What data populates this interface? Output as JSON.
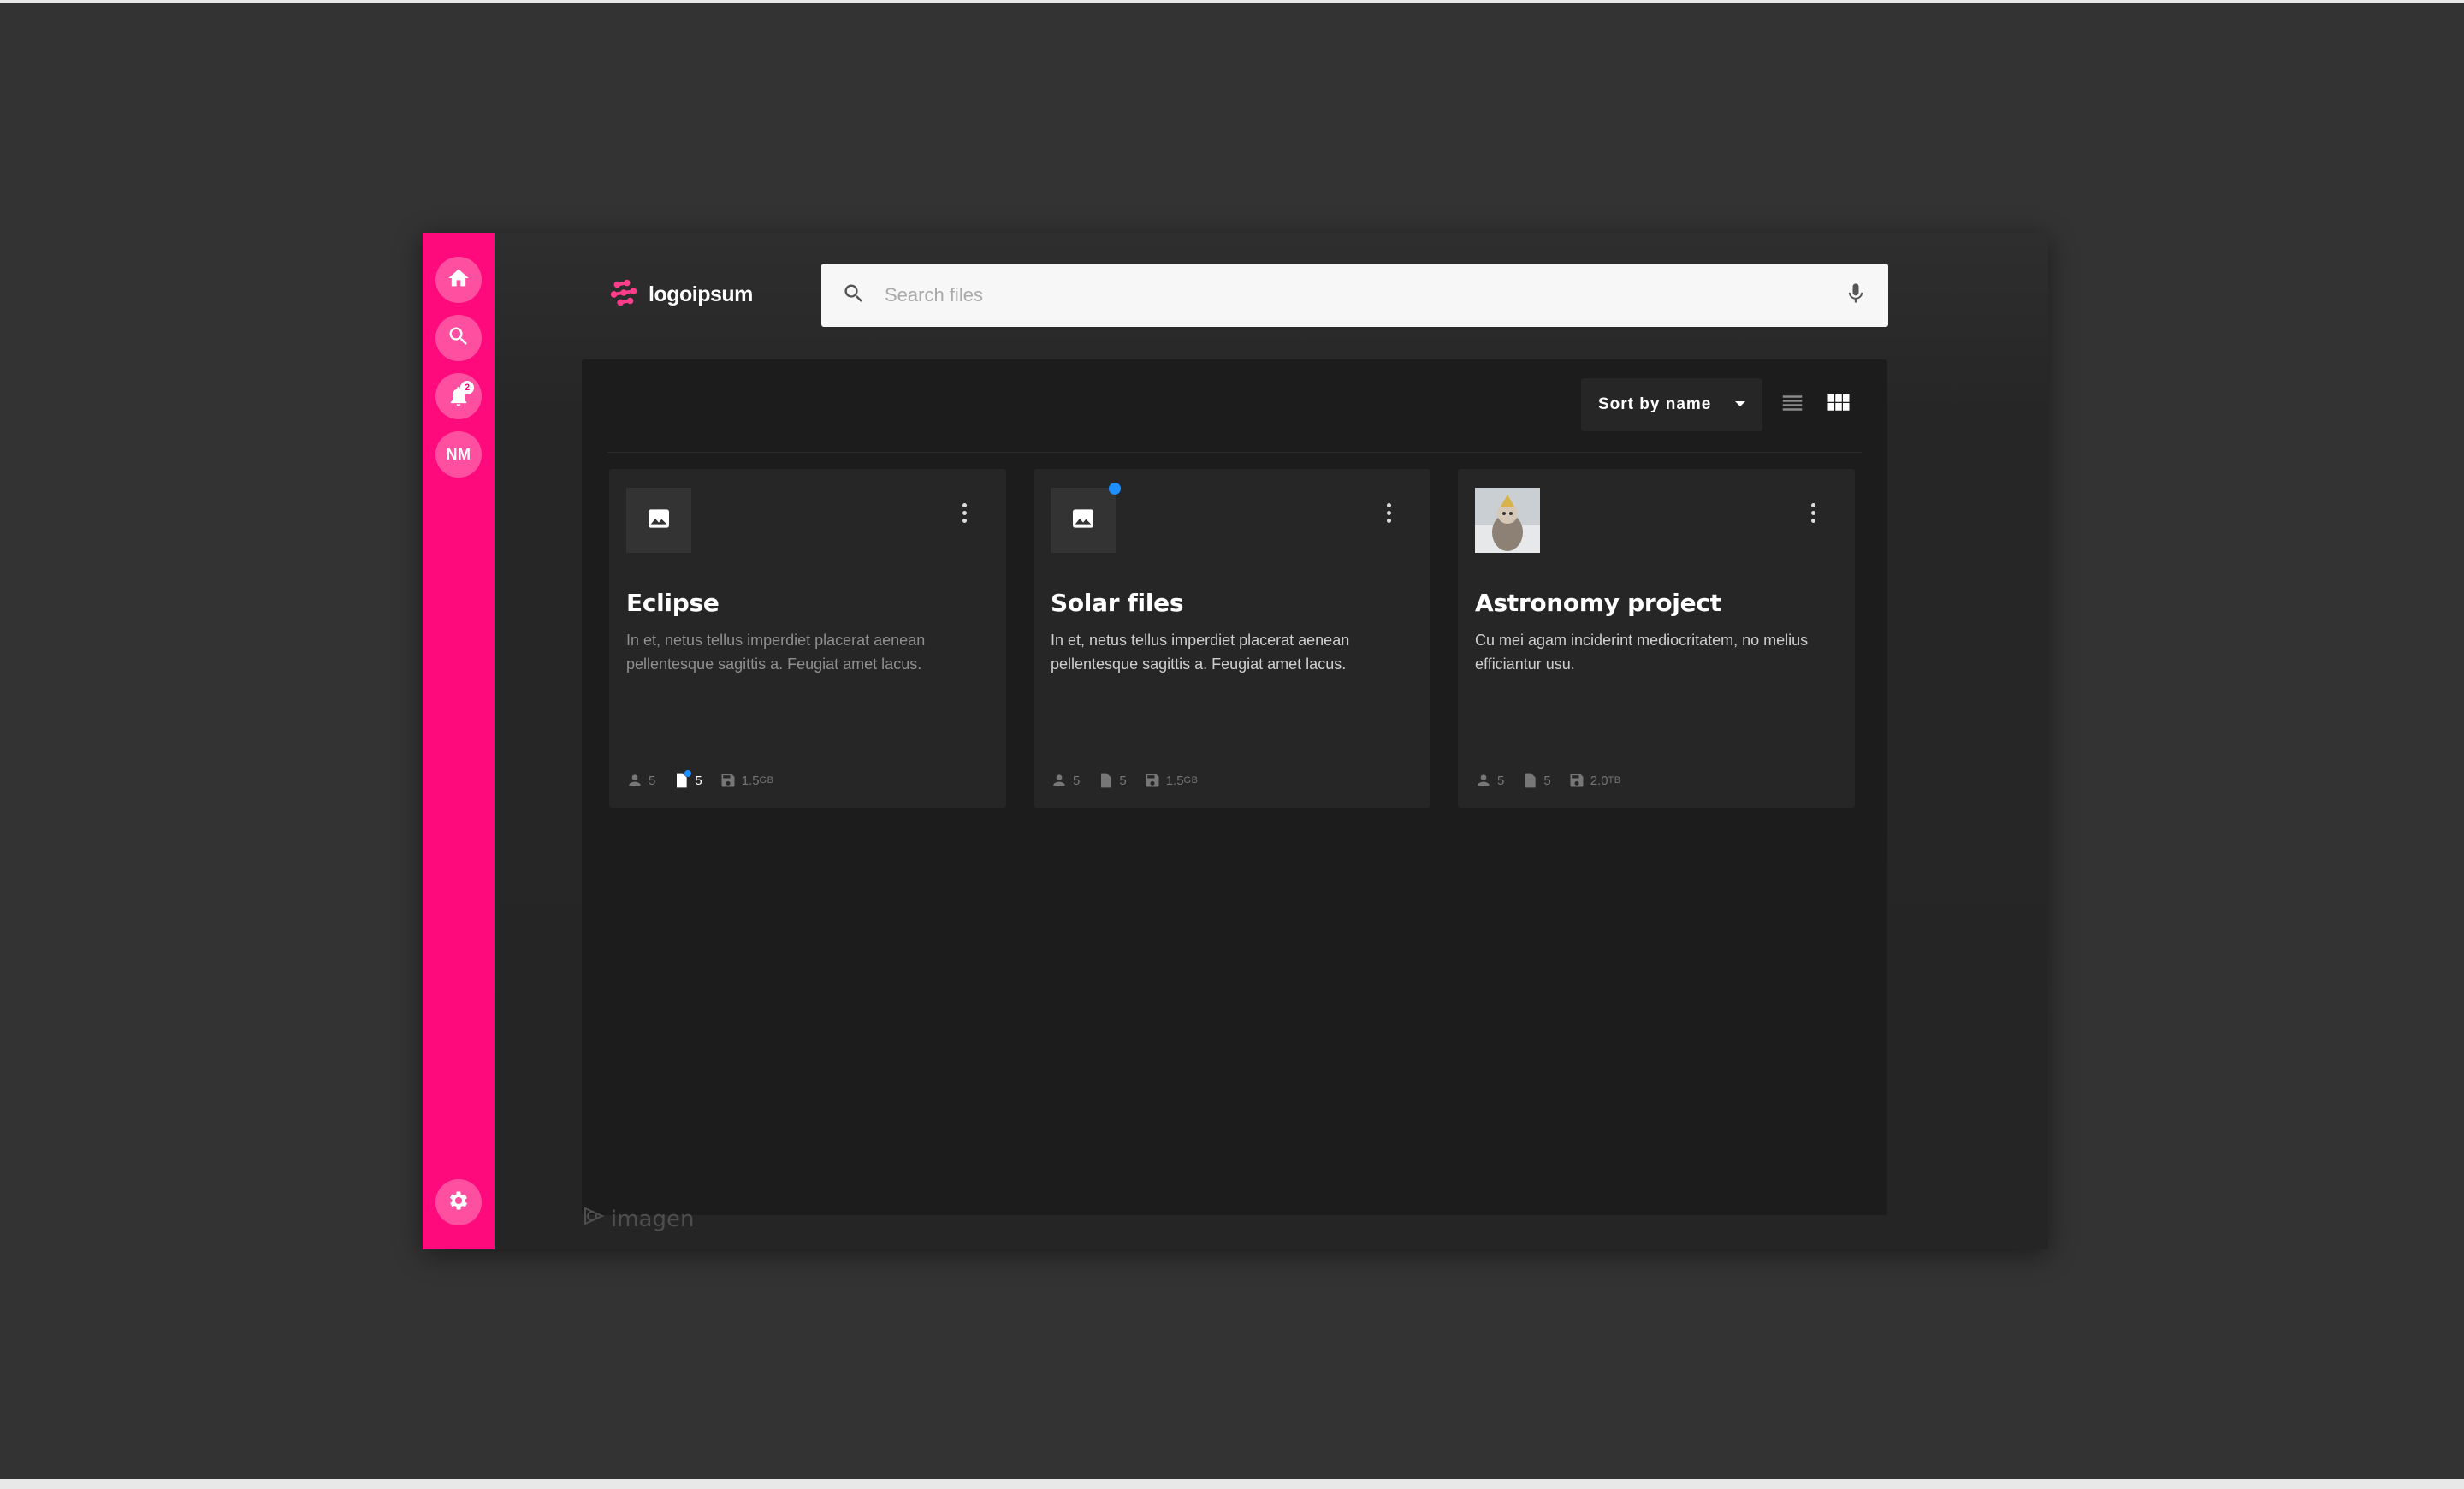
{
  "sidebar": {
    "items": [
      {
        "name": "home",
        "icon": "home-icon"
      },
      {
        "name": "search",
        "icon": "search-icon"
      },
      {
        "name": "notifications",
        "icon": "bell-icon",
        "badge": "2"
      },
      {
        "name": "profile",
        "avatar_initials": "NM"
      }
    ],
    "bottom": {
      "name": "settings",
      "icon": "gear-icon"
    },
    "color": "#ff0a7c"
  },
  "header": {
    "logo_text": "logoipsum",
    "search": {
      "placeholder": "Search files",
      "value": ""
    }
  },
  "toolbar": {
    "sort_label": "Sort by name",
    "view_modes": [
      "list-view",
      "grid-view"
    ],
    "active_view": "grid-view"
  },
  "cards": [
    {
      "title": "Eclipse",
      "description": "In et, netus tellus imperdiet placerat aenean pellentesque sagittis a. Feugiat amet lacus.",
      "thumbnail": "image-placeholder-icon",
      "members": "5",
      "files": "5",
      "size": "1.5",
      "size_unit": "GB"
    },
    {
      "title": "Solar files",
      "description": "In et, netus tellus imperdiet placerat aenean pellentesque sagittis a. Feugiat amet lacus.",
      "thumbnail": "image-placeholder-icon",
      "members": "5",
      "files": "5",
      "size": "1.5",
      "size_unit": "GB"
    },
    {
      "title": "Astronomy project",
      "description": "Cu mei agam inciderint mediocritatem, no melius efficiantur usu.",
      "thumbnail": "photo-thumbnail",
      "members": "5",
      "files": "5",
      "size": "2.0",
      "size_unit": "TB"
    }
  ],
  "footer": {
    "brand": "imagen"
  }
}
